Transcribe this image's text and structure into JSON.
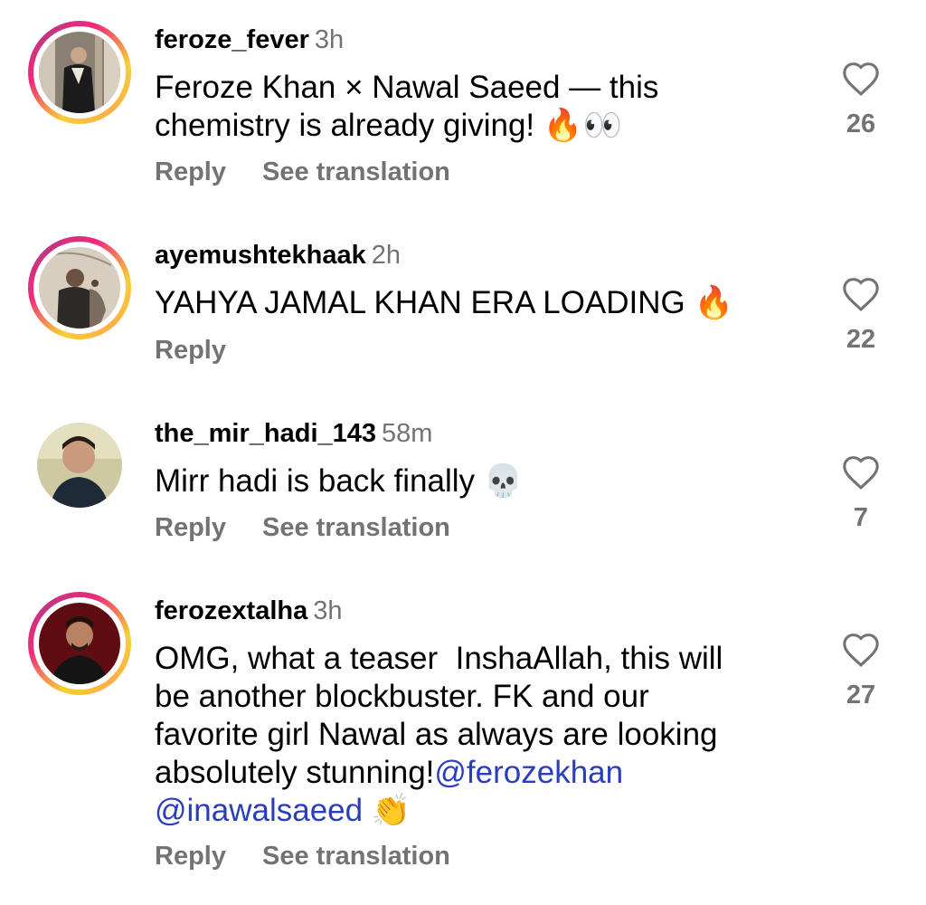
{
  "comments": [
    {
      "username": "feroze_fever",
      "time": "3h",
      "text": "Feroze Khan × Nawal Saeed — this\nchemistry is already giving! 🔥👀",
      "reply_label": "Reply",
      "translate_label": "See translation",
      "likes": "26",
      "has_story_ring": true
    },
    {
      "username": "ayemushtekhaak",
      "time": "2h",
      "text": "YAHYA JAMAL KHAN ERA LOADING 🔥",
      "reply_label": "Reply",
      "likes": "22",
      "has_story_ring": true
    },
    {
      "username": "the_mir_hadi_143",
      "time": "58m",
      "text": "Mirr hadi is back finally 💀",
      "reply_label": "Reply",
      "translate_label": "See translation",
      "likes": "7",
      "has_story_ring": false
    },
    {
      "username": "ferozextalha",
      "time": "3h",
      "text_main": "OMG, what a teaser  InshaAllah, this will\nbe another blockbuster. FK and our\nfavorite girl Nawal as always are looking\nabsolutely stunning!",
      "mention_1": "@ferozekhan",
      "mention_2": "@inawalsaeed",
      "text_tail": " 👏",
      "reply_label": "Reply",
      "translate_label": "See translation",
      "likes": "27",
      "has_story_ring": true
    }
  ],
  "colors": {
    "secondary_text": "#737373",
    "mention": "#2a3dbd",
    "story_ring": [
      "#f9ce34",
      "#ee2a7b",
      "#6228d7"
    ]
  },
  "icons": {
    "like": "heart-outline-icon"
  }
}
